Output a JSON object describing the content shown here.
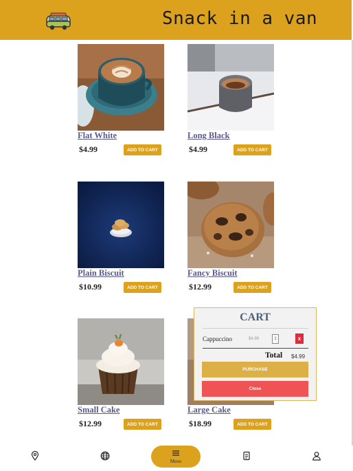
{
  "header": {
    "title": "Snack in a van",
    "logo_icon": "van-icon",
    "color": "#dca21e"
  },
  "products": [
    {
      "name": "Flat White",
      "price": "$4.99",
      "button": "ADD TO CART",
      "image": "coffee-cup-photo"
    },
    {
      "name": "Long Black",
      "price": "$4.99",
      "button": "ADD TO CART",
      "image": "espresso-cup-photo"
    },
    {
      "name": "Plain Biscuit",
      "price": "$10.99",
      "button": "ADD TO CART",
      "image": "biscuit-photo"
    },
    {
      "name": "Fancy Biscuit",
      "price": "$12.99",
      "button": "ADD TO CART",
      "image": "cookie-photo"
    },
    {
      "name": "Small Cake",
      "price": "$12.99",
      "button": "ADD TO CART",
      "image": "cupcake-photo"
    },
    {
      "name": "Large Cake",
      "price": "$18.99",
      "button": "ADD TO CART",
      "image": "cake-photo"
    }
  ],
  "cart": {
    "title": "CART",
    "items": [
      {
        "name": "Cappuccino",
        "price": "$4.99",
        "quantity": "1",
        "remove_label": "x"
      }
    ],
    "total_label": "Total",
    "total_value": "$4.99",
    "purchase_label": "PURCHASE",
    "close_label": "Close"
  },
  "bottom_nav": {
    "items": [
      {
        "icon": "location-pin-icon"
      },
      {
        "icon": "globe-icon"
      },
      {
        "icon": "menu-icon",
        "label": "Menu",
        "active": true
      },
      {
        "icon": "receipt-icon"
      },
      {
        "icon": "user-icon"
      }
    ]
  },
  "colors": {
    "accent": "#dca21e",
    "link": "#5a5a8e",
    "danger": "#ef5353",
    "cart_title": "#4c5f7c"
  }
}
